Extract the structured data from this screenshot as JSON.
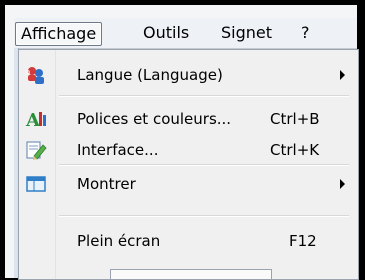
{
  "menubar": {
    "items": [
      {
        "label": "Affichage"
      },
      {
        "label": "Outils"
      },
      {
        "label": "Signet"
      },
      {
        "label": "?"
      }
    ]
  },
  "dropdown": {
    "items": [
      {
        "label": "Langue (Language)",
        "shortcut": "",
        "submenu": true,
        "icon": "language-icon"
      },
      {
        "label": "Polices et couleurs...",
        "shortcut": "Ctrl+B",
        "submenu": false,
        "icon": "font-icon"
      },
      {
        "label": "Interface...",
        "shortcut": "Ctrl+K",
        "submenu": false,
        "icon": "interface-edit-icon"
      },
      {
        "label": "Montrer",
        "shortcut": "",
        "submenu": true,
        "icon": "window-icon"
      },
      {
        "label": "Plein écran",
        "shortcut": "F12",
        "submenu": false,
        "icon": ""
      }
    ]
  },
  "colors": {
    "menu_bg": "#f0f0f0",
    "active_border": "#6c7a8c",
    "frame": "#000000"
  }
}
